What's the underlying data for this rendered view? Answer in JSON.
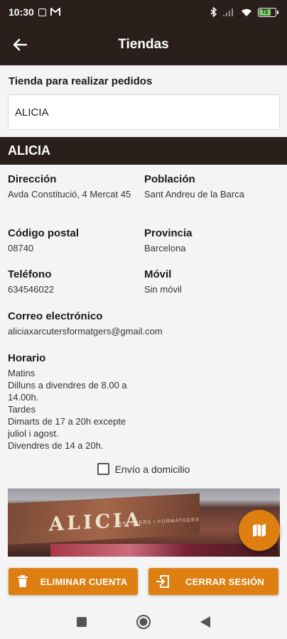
{
  "status_bar": {
    "time": "10:30",
    "battery_level": "72",
    "icons": [
      "sim-icon",
      "gmail-icon",
      "bluetooth-icon",
      "signal-icon",
      "wifi-icon",
      "battery-icon"
    ]
  },
  "app_bar": {
    "title": "Tiendas",
    "back_icon": "arrow-back-icon"
  },
  "store_select": {
    "label": "Tienda para realizar pedidos",
    "value": "ALICIA"
  },
  "store": {
    "name": "ALICIA",
    "address_label": "Dirección",
    "address": "Avda Constitució, 4 Mercat 45",
    "town_label": "Población",
    "town": "Sant Andreu de la Barca",
    "postcode_label": "Código postal",
    "postcode": "08740",
    "province_label": "Provincia",
    "province": "Barcelona",
    "phone_label": "Teléfono",
    "phone": "634546022",
    "mobile_label": "Móvil",
    "mobile": "Sin móvil",
    "email_label": "Correo electrónico",
    "email": "aliciaxarcutersformatgers@gmail.com",
    "schedule_label": "Horario",
    "schedule": "Matins\nDilluns a divendres de 8.00 a\n14.00h.\nTardes\nDimarts de 17 a 20h excepte\njuliol i agost.\nDivendres de 14 a 20h."
  },
  "delivery": {
    "label": "Envío a domicilio",
    "checked": false
  },
  "photo": {
    "logo_text": "ALICIA",
    "sub_text": "XARCUTERS I FORMATGERS"
  },
  "map_fab_icon": "map-icon",
  "actions": {
    "delete_label": "ELIMINAR CUENTA",
    "logout_label": "CERRAR SESIÓN"
  },
  "colors": {
    "header": "#2a1f1b",
    "accent": "#dd7f11",
    "background": "#f4f4f4"
  },
  "nav": [
    "square-icon",
    "circle-icon",
    "triangle-back-icon"
  ]
}
